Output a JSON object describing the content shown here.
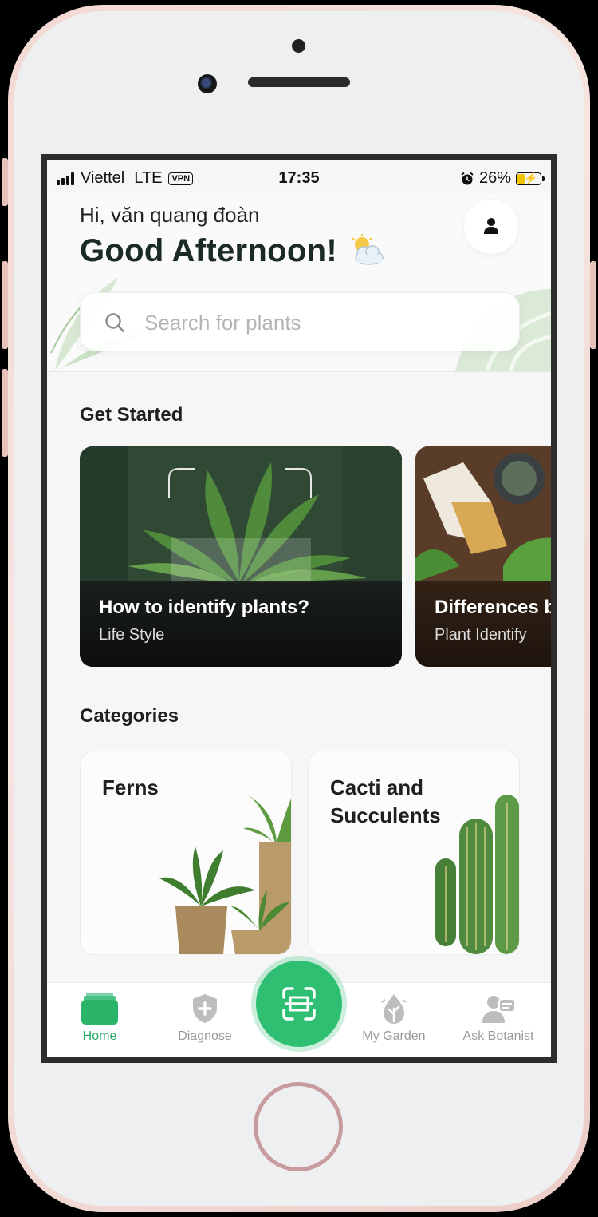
{
  "status_bar": {
    "carrier": "Viettel",
    "network": "LTE",
    "vpn": "VPN",
    "time": "17:35",
    "battery": "26%"
  },
  "header": {
    "greeting": "Hi, văn quang đoàn",
    "headline": "Good Afternoon!"
  },
  "search": {
    "placeholder": "Search for plants"
  },
  "get_started": {
    "title": "Get Started",
    "cards": [
      {
        "title": "How to identify plants?",
        "subtitle": "Life Style"
      },
      {
        "title": "Differences b",
        "subtitle": "Plant Identify"
      }
    ]
  },
  "categories": {
    "title": "Categories",
    "items": [
      {
        "label": "Ferns"
      },
      {
        "label": "Cacti and Succulents"
      }
    ]
  },
  "bottom_nav": {
    "items": [
      {
        "label": "Home"
      },
      {
        "label": "Diagnose"
      },
      {
        "label": "My Garden"
      },
      {
        "label": "Ask Botanist"
      }
    ]
  },
  "colors": {
    "accent": "#2fbf72",
    "active_nav": "#28a865",
    "inactive_nav": "#9a9a9a"
  }
}
